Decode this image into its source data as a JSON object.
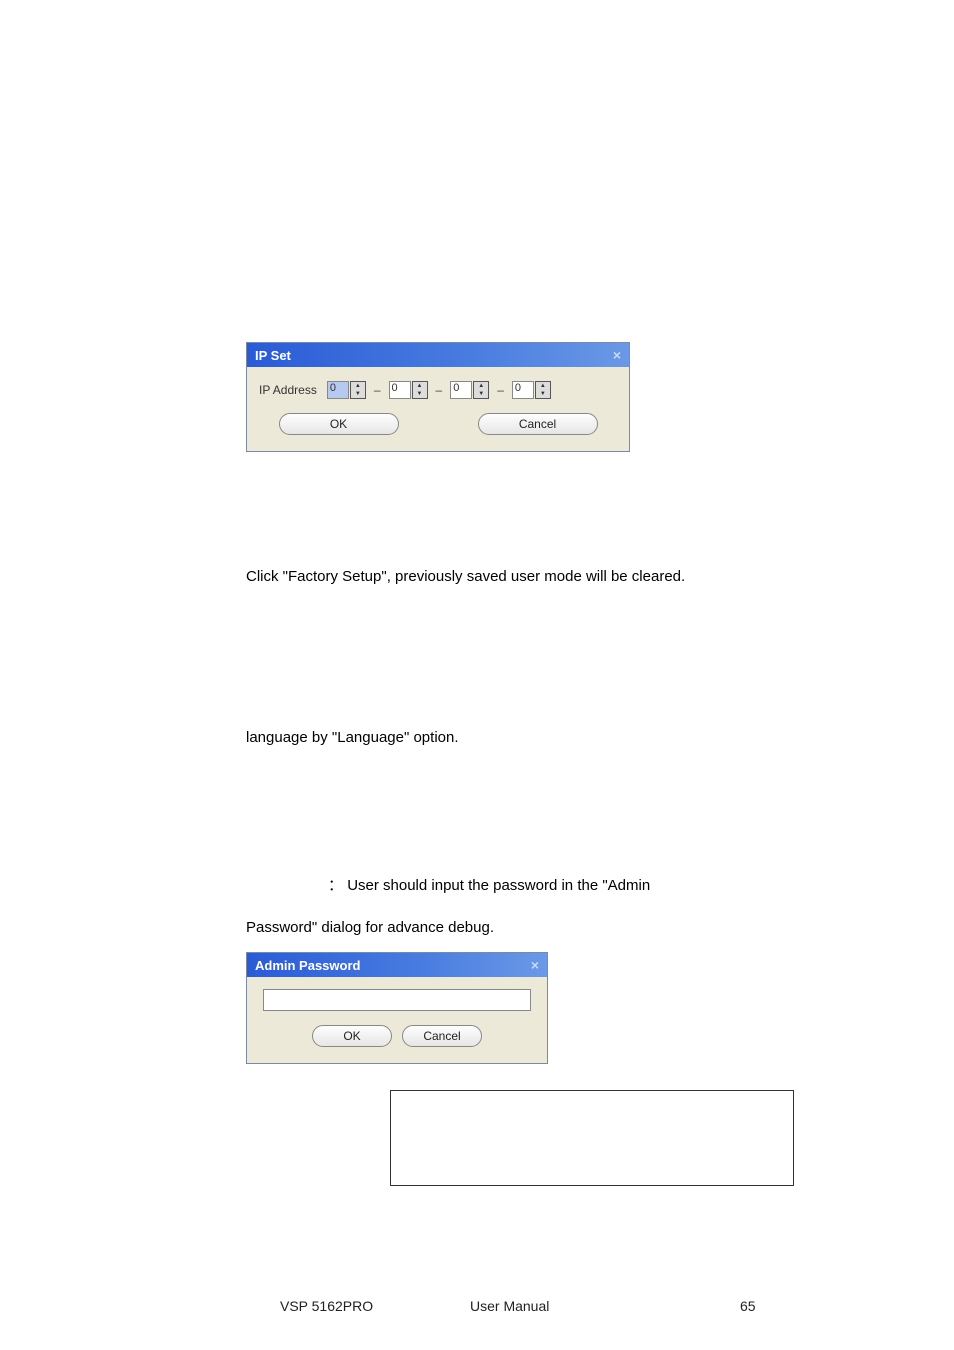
{
  "ipset": {
    "title": "IP Set",
    "label": "IP Address",
    "seg1": "0",
    "seg2": "0",
    "seg3": "0",
    "seg4": "0",
    "sep": "–",
    "ok": "OK",
    "cancel": "Cancel"
  },
  "para_factory": "Click \"Factory Setup\", previously saved user mode will be cleared.",
  "para_language": "language by \"Language\" option.",
  "para_admin_colon": "：",
  "para_admin_line1": "User should input the password in the \"Admin",
  "para_admin_line2": "Password\" dialog for advance debug.",
  "admin": {
    "title": "Admin Password",
    "ok": "OK",
    "cancel": "Cancel"
  },
  "footer": {
    "left": "VSP 5162PRO",
    "center": "User Manual",
    "right": "65"
  }
}
